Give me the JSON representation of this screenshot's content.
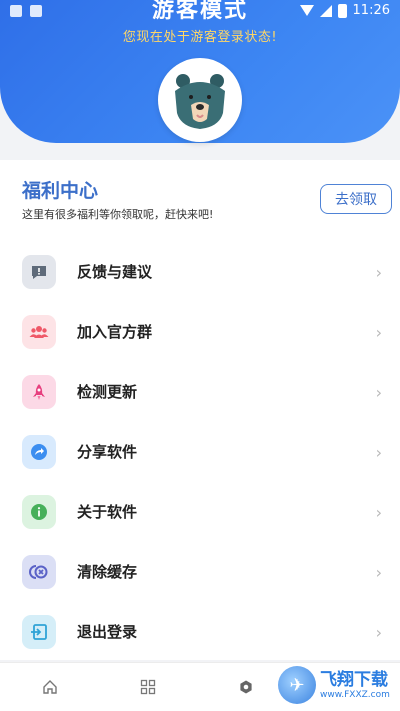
{
  "status_bar": {
    "time": "11:26"
  },
  "header": {
    "title": "游客模式",
    "subtitle": "您现在处于游客登录状态!"
  },
  "welfare": {
    "title": "福利中心",
    "description": "这里有很多福利等你领取呢，赶快来吧!",
    "button_label": "去领取"
  },
  "menu": {
    "items": [
      {
        "label": "反馈与建议",
        "icon": "feedback-icon",
        "icon_bg": "#e3e6ec",
        "icon_color": "#5f6b7a"
      },
      {
        "label": "加入官方群",
        "icon": "group-icon",
        "icon_bg": "#fde3e6",
        "icon_color": "#ef5868"
      },
      {
        "label": "检测更新",
        "icon": "rocket-icon",
        "icon_bg": "#fcd9e6",
        "icon_color": "#e7407f"
      },
      {
        "label": "分享软件",
        "icon": "share-icon",
        "icon_bg": "#d8eafd",
        "icon_color": "#3c8ef0"
      },
      {
        "label": "关于软件",
        "icon": "info-icon",
        "icon_bg": "#dcf3e0",
        "icon_color": "#47b05a"
      },
      {
        "label": "清除缓存",
        "icon": "clear-cache-icon",
        "icon_bg": "#dbdff5",
        "icon_color": "#5a62c7"
      },
      {
        "label": "退出登录",
        "icon": "logout-icon",
        "icon_bg": "#d5eef8",
        "icon_color": "#2fa3d6"
      }
    ],
    "chevron": "›"
  },
  "tabbar": {
    "tabs": [
      {
        "icon": "home-icon"
      },
      {
        "icon": "grid-icon"
      },
      {
        "icon": "settings-icon"
      }
    ]
  },
  "watermark": {
    "text": "飞翔下载",
    "url": "www.FXXZ.com"
  }
}
